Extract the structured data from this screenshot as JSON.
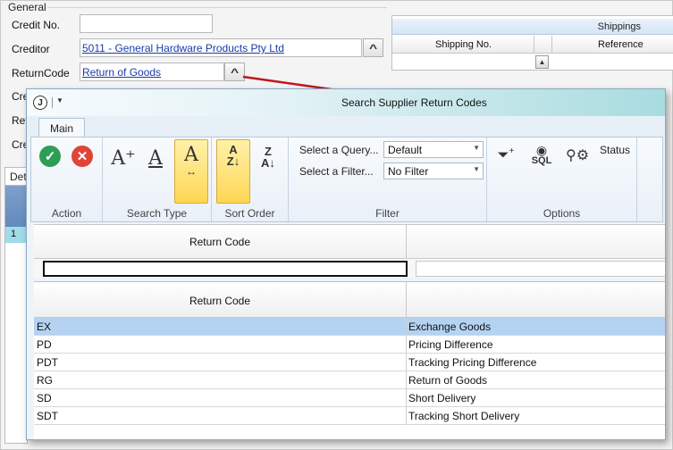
{
  "form": {
    "group_title": "General",
    "fields": {
      "credit_no": {
        "label": "Credit No.",
        "value": ""
      },
      "creditor": {
        "label": "Creditor",
        "value": "5011 - General Hardware Products Pty Ltd"
      },
      "return_code": {
        "label": "ReturnCode",
        "value": "Return of Goods"
      },
      "partial_label_1": "Cre",
      "partial_label_2": "Ref",
      "partial_label_3": "Cre"
    },
    "shippings": {
      "title": "Shippings",
      "columns": [
        "Shipping No.",
        "Reference"
      ]
    },
    "left_tab": "Det",
    "left_row": "1"
  },
  "dialog": {
    "title": "Search Supplier Return Codes",
    "app_icon_letter": "J",
    "tabs": [
      "Main"
    ],
    "ribbon": {
      "action_group": "Action",
      "search_type_group": "Search Type",
      "sort_order_group": "Sort Order",
      "filter_group": "Filter",
      "options_group": "Options",
      "select_query_label": "Select a Query...",
      "select_query_value": "Default",
      "select_filter_label": "Select a Filter...",
      "select_filter_value": "No Filter",
      "sql_label": "SQL",
      "status_label": "Status"
    },
    "filter_grid": {
      "column": "Return Code",
      "value": ""
    },
    "results": {
      "column": "Return Code",
      "rows": [
        {
          "code": "EX",
          "description": "Exchange Goods"
        },
        {
          "code": "PD",
          "description": "Pricing Difference"
        },
        {
          "code": "PDT",
          "description": "Tracking Pricing Difference"
        },
        {
          "code": "RG",
          "description": "Return of Goods"
        },
        {
          "code": "SD",
          "description": "Short Delivery"
        },
        {
          "code": "SDT",
          "description": "Tracking Short Delivery"
        }
      ]
    }
  },
  "colors": {
    "accent_arrow": "#c0171d",
    "selected_row": "#b4d3f2",
    "active_button": "#ffd655"
  }
}
